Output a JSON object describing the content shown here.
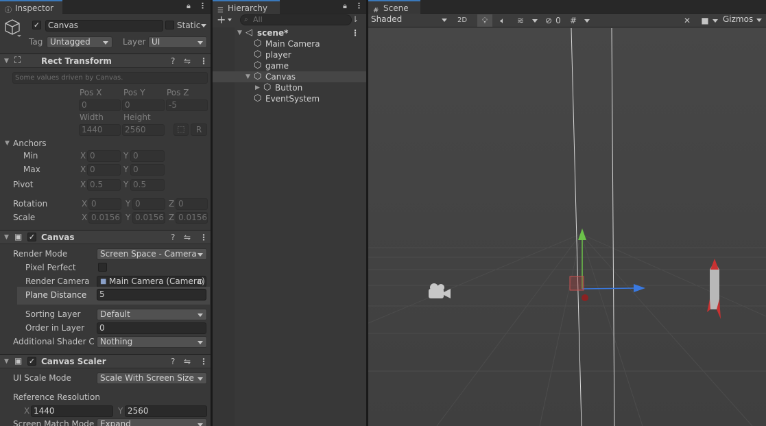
{
  "inspector": {
    "tab_title": "Inspector",
    "object_name": "Canvas",
    "static_label": "Static",
    "tag_label": "Tag",
    "tag_value": "Untagged",
    "layer_label": "Layer",
    "layer_value": "UI",
    "rect_transform": {
      "title": "Rect Transform",
      "note": "Some values driven by Canvas.",
      "pos_x_label": "Pos X",
      "pos_y_label": "Pos Y",
      "pos_z_label": "Pos Z",
      "pos_x": "0",
      "pos_y": "0",
      "pos_z": "-5",
      "width_label": "Width",
      "height_label": "Height",
      "width": "1440",
      "height": "2560",
      "r_button": "R",
      "anchors_label": "Anchors",
      "min_label": "Min",
      "max_label": "Max",
      "min_x": "0",
      "min_y": "0",
      "max_x": "0",
      "max_y": "0",
      "pivot_label": "Pivot",
      "pivot_x": "0.5",
      "pivot_y": "0.5",
      "rotation_label": "Rotation",
      "rot_x": "0",
      "rot_y": "0",
      "rot_z": "0",
      "scale_label": "Scale",
      "scale_x": "0.0156:",
      "scale_y": "0.0156:",
      "scale_z": "0.0156:",
      "axis_x": "X",
      "axis_y": "Y",
      "axis_z": "Z"
    },
    "canvas": {
      "title": "Canvas",
      "render_mode_label": "Render Mode",
      "render_mode_value": "Screen Space - Camera",
      "pixel_perfect_label": "Pixel Perfect",
      "render_camera_label": "Render Camera",
      "render_camera_value": "Main Camera (Camera)",
      "plane_distance_label": "Plane Distance",
      "plane_distance_value": "5",
      "sorting_layer_label": "Sorting Layer",
      "sorting_layer_value": "Default",
      "order_in_layer_label": "Order in Layer",
      "order_in_layer_value": "0",
      "shader_channels_label": "Additional Shader Ch",
      "shader_channels_value": "Nothing"
    },
    "canvas_scaler": {
      "title": "Canvas Scaler",
      "ui_scale_mode_label": "UI Scale Mode",
      "ui_scale_mode_value": "Scale With Screen Size",
      "ref_res_label": "Reference Resolution",
      "ref_x_label": "X",
      "ref_x": "1440",
      "ref_y_label": "Y",
      "ref_y": "2560",
      "screen_match_label": "Screen Match Mode",
      "screen_match_value": "Expand"
    }
  },
  "hierarchy": {
    "tab_title": "Hierarchy",
    "search_placeholder": "All",
    "add_label": "+",
    "items": [
      {
        "label": "scene*",
        "depth": 0,
        "kind": "scene"
      },
      {
        "label": "Main Camera",
        "depth": 1,
        "kind": "object"
      },
      {
        "label": "player",
        "depth": 1,
        "kind": "object"
      },
      {
        "label": "game",
        "depth": 1,
        "kind": "object"
      },
      {
        "label": "Canvas",
        "depth": 1,
        "kind": "object",
        "selected": true,
        "expanded": true
      },
      {
        "label": "Button",
        "depth": 2,
        "kind": "object",
        "collapsed": true
      },
      {
        "label": "EventSystem",
        "depth": 1,
        "kind": "object"
      }
    ]
  },
  "scene": {
    "tab_title": "Scene",
    "shading_mode": "Shaded",
    "mode_2d": "2D",
    "hidden_count": "0",
    "gizmos_label": "Gizmos"
  },
  "colors": {
    "accent": "#3a79bb",
    "y_axis": "#6cc24a",
    "x_axis": "#3a79e0",
    "selected_row": "#464646"
  }
}
